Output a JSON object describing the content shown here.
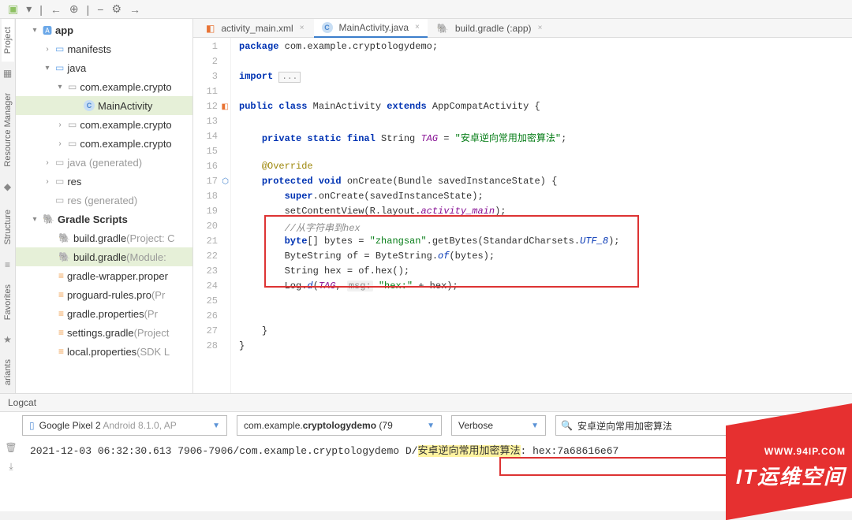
{
  "toolbar": {
    "items": [
      "android",
      "arrow",
      "add",
      "sep",
      "minus",
      "gear",
      "arrow-r"
    ]
  },
  "side_tabs": [
    "Project",
    "Resource Manager"
  ],
  "side_tabs_bottom": [
    "Structure",
    "Favorites",
    "ariants"
  ],
  "tree": {
    "app": "app",
    "manifests": "manifests",
    "java": "java",
    "pkg1": "com.example.crypto",
    "main_activity": "MainActivity",
    "pkg2": "com.example.crypto",
    "pkg3": "com.example.crypto",
    "java_gen": "java",
    "java_gen_suffix": " (generated)",
    "res": "res",
    "res_gen": "res",
    "res_gen_suffix": " (generated)",
    "gradle_scripts": "Gradle Scripts",
    "build_gradle1": "build.gradle",
    "build_gradle1_suffix": " (Project: C",
    "build_gradle2": "build.gradle",
    "build_gradle2_suffix": " (Module: ",
    "gradle_wrapper": "gradle-wrapper.proper",
    "proguard": "proguard-rules.pro",
    "proguard_suffix": " (Pr",
    "gradle_props": "gradle.properties",
    "gradle_props_suffix": " (Pr",
    "settings_gradle": "settings.gradle",
    "settings_gradle_suffix": " (Project",
    "local_props": "local.properties",
    "local_props_suffix": " (SDK L"
  },
  "tabs": [
    {
      "icon": "xml",
      "label": "activity_main.xml"
    },
    {
      "icon": "java",
      "label": "MainActivity.java"
    },
    {
      "icon": "gradle",
      "label": "build.gradle (:app)"
    }
  ],
  "line_numbers": [
    "1",
    "2",
    "3",
    "11",
    "12",
    "13",
    "14",
    "15",
    "16",
    "17",
    "18",
    "19",
    "20",
    "21",
    "22",
    "23",
    "24",
    "25",
    "26",
    "27",
    "28"
  ],
  "code": {
    "l1_pkg": "package",
    "l1_name": " com.example.cryptologydemo;",
    "l3_import": "import",
    "l3_fold": "...",
    "l12_public": "public class",
    "l12_name": " MainActivity ",
    "l12_extends": "extends",
    "l12_super": " AppCompatActivity {",
    "l14_mods": "private static final",
    "l14_type": " String ",
    "l14_field": "TAG",
    "l14_eq": " = ",
    "l14_str": "\"安卓逆向常用加密算法\"",
    "l14_end": ";",
    "l16_anno": "@Override",
    "l17_prot": "protected void",
    "l17_name": " onCreate(Bundle savedInstanceState) {",
    "l18_super": "super",
    "l18_rest": ".onCreate(savedInstanceState);",
    "l19_a": "setContentView(R.layout.",
    "l19_b": "activity_main",
    "l19_c": ");",
    "l20_cmt": "//从字符串到hex",
    "l21_byte": "byte",
    "l21_rest1": "[] bytes = ",
    "l21_str": "\"zhangsan\"",
    "l21_rest2": ".getBytes(StandardCharsets.",
    "l21_utf": "UTF_8",
    "l21_end": ");",
    "l22_a": "ByteString of = ByteString.",
    "l22_b": "of",
    "l22_c": "(bytes);",
    "l23": "String hex = of.hex();",
    "l24_a": "Log.",
    "l24_b": "d",
    "l24_c": "(",
    "l24_tag": "TAG",
    "l24_d": ", ",
    "l24_param": "msg:",
    "l24_e": " ",
    "l24_str": "\"hex:\"",
    "l24_f": " + hex);",
    "l27": "}",
    "l28": "}"
  },
  "logcat": {
    "title": "Logcat",
    "device": "Google Pixel 2",
    "device_suffix": " Android 8.1.0, AP",
    "process_a": "com.example.",
    "process_b": "cryptologydemo",
    "process_c": " (79",
    "level": "Verbose",
    "search": "安卓逆向常用加密算法",
    "log_time": "2021-12-03 06:32:30.613 7906-7906/com.example.cryptologydemo ",
    "log_tag": "D/",
    "log_match": "安卓逆向常用加密算法",
    "log_rest": ": hex:7a68616e67"
  },
  "watermark": {
    "url": "WWW.94IP.COM",
    "text": "IT运维空间"
  }
}
